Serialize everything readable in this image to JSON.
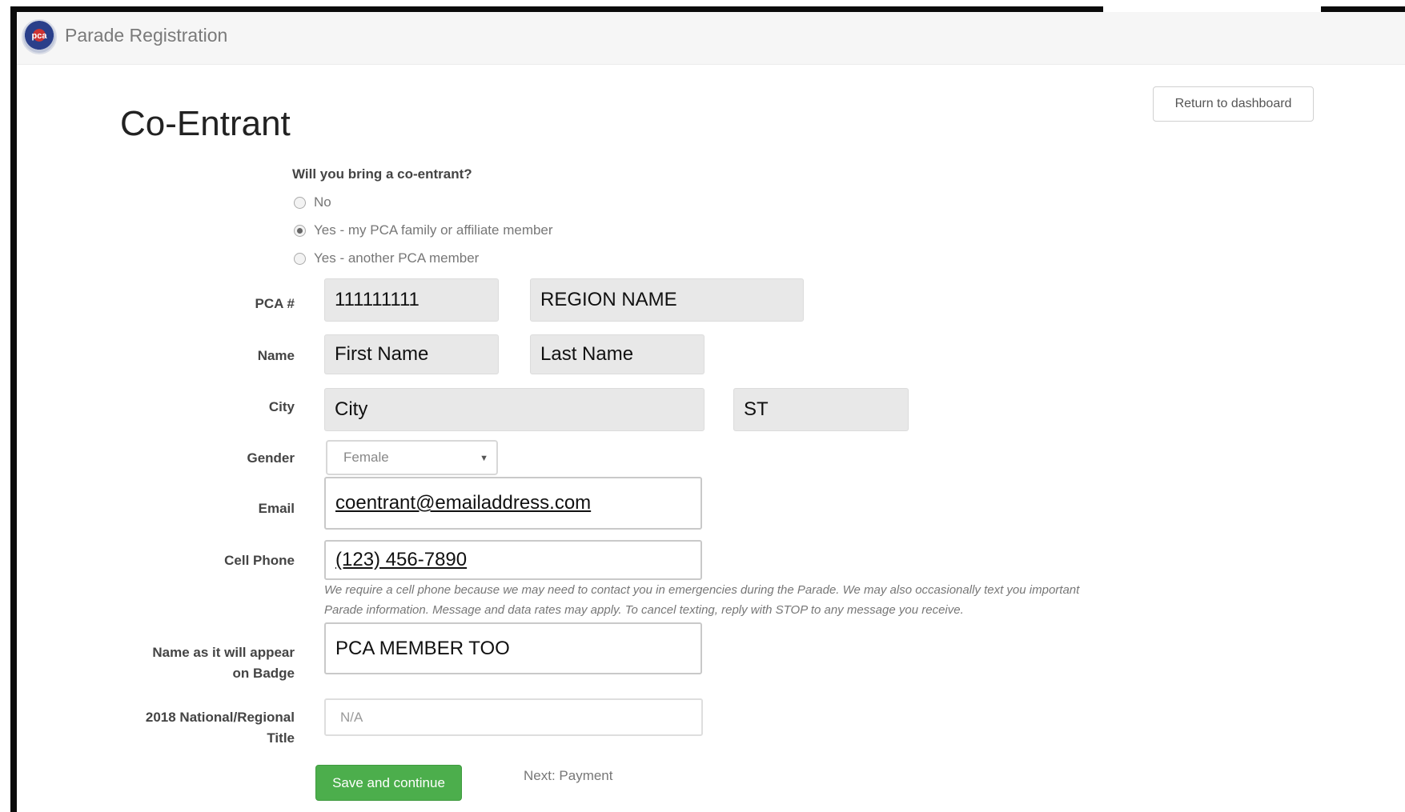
{
  "app": {
    "brand": "Parade Registration",
    "logo_text": "pca"
  },
  "header": {
    "return_label": "Return to dashboard"
  },
  "page": {
    "title": "Co-Entrant",
    "question": "Will you bring a co-entrant?",
    "options": [
      {
        "label": "No",
        "checked": false
      },
      {
        "label": "Yes - my PCA family or affiliate member",
        "checked": true
      },
      {
        "label": "Yes - another PCA member",
        "checked": false
      }
    ]
  },
  "form": {
    "labels": {
      "pca": "PCA #",
      "name": "Name",
      "city": "City",
      "gender": "Gender",
      "email": "Email",
      "cell": "Cell Phone",
      "badge_line1": "Name as it will appear",
      "badge_line2": "on Badge",
      "title_line1": "2018 National/Regional",
      "title_line2": "Title"
    },
    "values": {
      "pca_number": "111111111",
      "region": "REGION NAME",
      "first_name": "First Name",
      "last_name": "Last Name",
      "city": "City",
      "state": "ST",
      "gender": "Female",
      "email": "coentrant@emailaddress.com",
      "cell": "(123) 456-7890",
      "badge_name": "PCA MEMBER TOO",
      "title": "N/A"
    },
    "help_line1": "We require a cell phone because we may need to contact you in emergencies during the Parade. We may also occasionally text you important",
    "help_line2": "Parade information. Message and data rates may apply. To cancel texting, reply with STOP to any message you receive."
  },
  "footer": {
    "save_label": "Save and continue",
    "next_label": "Next: Payment"
  },
  "colors": {
    "primary_button": "#4cae4c",
    "field_bg": "#e8e8e8",
    "navbar_bg": "#f6f6f6"
  }
}
